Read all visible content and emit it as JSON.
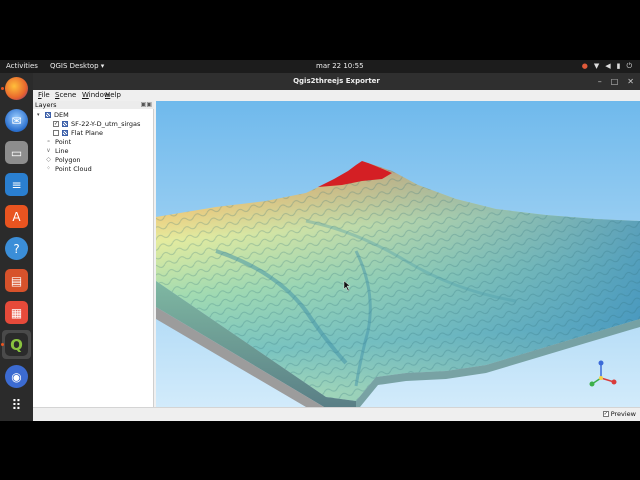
{
  "topbar": {
    "activities": "Activities",
    "app_menu": "QGIS Desktop ▾",
    "clock": "mar 22  10:55",
    "tray_icons": [
      "update-icon",
      "network-icon",
      "volume-icon",
      "microphone-icon",
      "power-icon"
    ]
  },
  "dock": {
    "apps": [
      "firefox-icon",
      "thunderbird-icon",
      "files-icon",
      "writer-icon",
      "software-icon",
      "help-icon",
      "impress-icon",
      "calc-icon",
      "qgis-icon",
      "app-icon",
      "show-apps-icon"
    ],
    "colors": {
      "firefox": "#e8662d",
      "thunderbird": "#2a6fce",
      "files": "#a0a0a0",
      "writer": "#2a7fd0",
      "software": "#e95420",
      "help": "#3b8ed8",
      "impress": "#d7522b",
      "calc": "#e64a3a",
      "qgis": "#589632",
      "app": "#3c6bd1"
    }
  },
  "window": {
    "title": "Qgis2threejs Exporter",
    "controls": [
      "–",
      "□",
      "✕"
    ]
  },
  "menu": {
    "file": "File",
    "scene": "Scene",
    "window": "Window",
    "help": "Help"
  },
  "layers": {
    "title": "Layers",
    "dem_group": "DEM",
    "dem_items": [
      {
        "label": "SF-22-Y-D_utm_sirgas",
        "checked": true
      },
      {
        "label": "Flat Plane",
        "checked": false
      }
    ],
    "groups": [
      "Point",
      "Line",
      "Polygon",
      "Point Cloud"
    ]
  },
  "statusbar": {
    "preview_label": "Preview",
    "preview_checked": true
  }
}
